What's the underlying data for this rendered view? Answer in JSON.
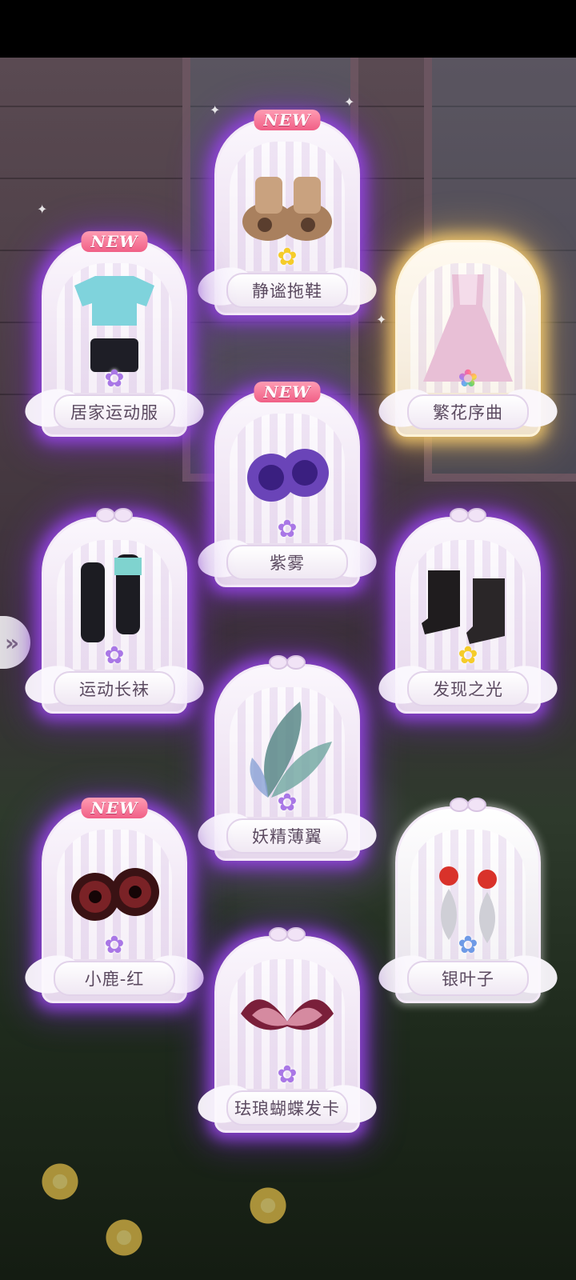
{
  "new_badge": "NEW",
  "nav": {
    "arrow_glyph": "»"
  },
  "items": [
    {
      "name": "静谧拖鞋",
      "is_new": true,
      "rarity": "gold"
    },
    {
      "name": "居家运动服",
      "is_new": true,
      "rarity": "purple"
    },
    {
      "name": "繁花序曲",
      "is_new": false,
      "rarity": "multi"
    },
    {
      "name": "紫雾",
      "is_new": true,
      "rarity": "purple"
    },
    {
      "name": "运动长袜",
      "is_new": false,
      "rarity": "purple"
    },
    {
      "name": "发现之光",
      "is_new": false,
      "rarity": "gold"
    },
    {
      "name": "妖精薄翼",
      "is_new": false,
      "rarity": "purple"
    },
    {
      "name": "小鹿-红",
      "is_new": true,
      "rarity": "purple"
    },
    {
      "name": "银叶子",
      "is_new": false,
      "rarity": "blue"
    },
    {
      "name": "珐琅蝴蝶发卡",
      "is_new": false,
      "rarity": "purple"
    }
  ],
  "rarity_glyph": "✿",
  "colors": {
    "glow_purple": "#9646e6",
    "glow_gold": "#ffd26e",
    "new_badge": "#f05f86"
  }
}
